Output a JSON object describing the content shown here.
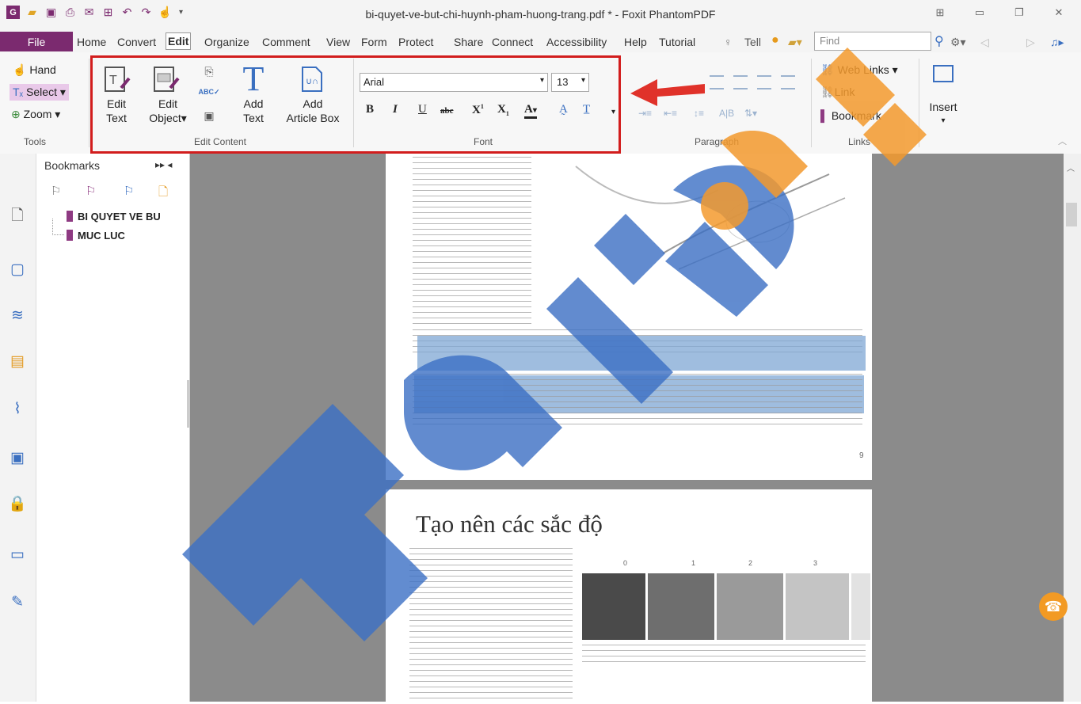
{
  "window": {
    "title": "bi-quyet-ve-but-chi-huynh-pham-huong-trang.pdf * - Foxit PhantomPDF"
  },
  "menu": {
    "file": "File",
    "items": [
      "Home",
      "Convert",
      "Edit",
      "Organize",
      "Comment",
      "View",
      "Form",
      "Protect",
      "Share",
      "Connect",
      "Accessibility",
      "Help",
      "Tutorial"
    ],
    "tell": "Tell",
    "find_placeholder": "Find"
  },
  "ribbon": {
    "tools": {
      "hand": "Hand",
      "select": "Select",
      "zoom": "Zoom",
      "group": "Tools"
    },
    "edit_content": {
      "edit_text_1": "Edit",
      "edit_text_2": "Text",
      "edit_object_1": "Edit",
      "edit_object_2": "Object",
      "add_text_1": "Add",
      "add_text_2": "Text",
      "add_article_1": "Add",
      "add_article_2": "Article Box",
      "group": "Edit Content"
    },
    "font": {
      "family": "Arial",
      "size": "13",
      "bold": "B",
      "italic": "I",
      "underline": "U",
      "strike": "abc",
      "superscript": "X",
      "subscript": "X",
      "color": "A",
      "group": "Font"
    },
    "paragraph": {
      "group": "Paragraph"
    },
    "links": {
      "web_links": "Web Links",
      "link": "Link",
      "bookmark": "Bookmark",
      "group": "Links"
    },
    "insert": {
      "label": "Insert"
    }
  },
  "bookmarks": {
    "title": "Bookmarks",
    "items": [
      "BI QUYET VE BU",
      "MUC LUC"
    ]
  },
  "document": {
    "page_number": "9",
    "page2_heading": "Tạo nên các sắc độ",
    "swatch_labels": [
      "0",
      "1",
      "2",
      "3"
    ]
  },
  "colors": {
    "file_tab": "#7b2a6f",
    "highlight_box": "#d21d1d",
    "bookmark_purple": "#8e3a82",
    "watermark_blue": "#3b6fc4",
    "watermark_orange": "#f39a2e"
  }
}
